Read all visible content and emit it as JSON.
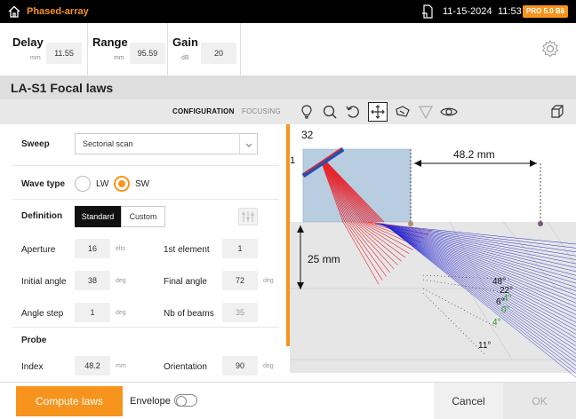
{
  "topbar": {
    "app_title": "Phased-array",
    "date": "11-15-2024",
    "time": "11:53",
    "version_badge": "PRO 5.0 B6",
    "home_icon": "home-icon",
    "file_icon": "file-icon"
  },
  "params": {
    "delay": {
      "label": "Delay",
      "unit": "mm",
      "value": "11.55"
    },
    "range": {
      "label": "Range",
      "unit": "mm",
      "value": "95.59"
    },
    "gain": {
      "label": "Gain",
      "unit": "dB",
      "value": "20"
    },
    "settings_icon": "gear-icon"
  },
  "section_title": "LA-S1 Focal laws",
  "tabs": {
    "configuration": "CONFIGURATION",
    "focusing": "FOCUSING"
  },
  "tools": [
    "lightbulb-icon",
    "zoom-icon",
    "rotate-icon",
    "move-icon",
    "wedge-icon",
    "cone-icon",
    "eye-icon",
    "cube-icon"
  ],
  "form": {
    "sweep": {
      "label": "Sweep",
      "value": "Sectorial scan"
    },
    "wave_type": {
      "label": "Wave type",
      "options": [
        "LW",
        "SW"
      ],
      "selected": "SW"
    },
    "definition": {
      "label": "Definition",
      "options": [
        "Standard",
        "Custom"
      ],
      "selected": "Standard"
    },
    "aperture": {
      "label": "Aperture",
      "value": "16",
      "unit": "elts"
    },
    "first_element": {
      "label": "1st element",
      "value": "1"
    },
    "initial_angle": {
      "label": "Initial angle",
      "value": "38",
      "unit": "deg"
    },
    "final_angle": {
      "label": "Final angle",
      "value": "72",
      "unit": "deg"
    },
    "angle_step": {
      "label": "Angle step",
      "value": "1",
      "unit": "deg"
    },
    "nb_beams": {
      "label": "Nb of beams",
      "value": "35"
    },
    "probe_header": "Probe",
    "index": {
      "label": "Index",
      "value": "48.2",
      "unit": "mm"
    },
    "orientation": {
      "label": "Orientation",
      "value": "90",
      "unit": "deg"
    }
  },
  "viz": {
    "probe_label_top": "32",
    "probe_label_left": "1",
    "index_offset": "48.2 mm",
    "thickness": "25 mm",
    "angle_labels": [
      "48°",
      "22°",
      "4°",
      "6°",
      "0°",
      "4°",
      "11°"
    ],
    "colors": {
      "beam_red": "#e8242b",
      "beam_blue": "#2b2bd0",
      "wedge": "#b9cde0",
      "part": "#e4e4e4"
    }
  },
  "bottom": {
    "compute_label": "Compute laws",
    "envelope_label": "Envelope",
    "envelope_on": false,
    "cancel_label": "Cancel",
    "ok_label": "OK"
  }
}
